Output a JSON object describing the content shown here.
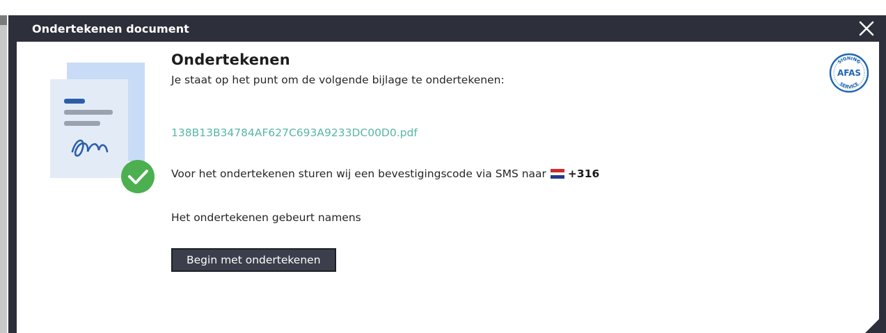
{
  "dialog": {
    "title": "Ondertekenen document",
    "close_icon": "close-icon"
  },
  "content": {
    "heading": "Ondertekenen",
    "intro": "Je staat op het punt om de volgende bijlage te ondertekenen:",
    "attachment_filename": "138B13B34784AF627C693A9233DC00D0.pdf",
    "sms_text": "Voor het ondertekenen sturen wij een bevestigingscode via SMS naar",
    "phone_prefix": "+316",
    "behalf_text": "Het ondertekenen gebeurt namens",
    "begin_button_label": "Begin met ondertekenen"
  },
  "badge": {
    "top_text": "SIGNING",
    "brand_text": "AFAS",
    "bottom_text": "SERVICE"
  },
  "colors": {
    "titlebar": "#2d2f3a",
    "link": "#58b7a6",
    "button": "#3b3f4c",
    "check_green": "#4caf50",
    "afas_blue": "#1f66b3"
  },
  "icons": {
    "document": "document-signature-icon",
    "check": "check-circle-icon",
    "flag": "netherlands-flag-icon",
    "badge": "afas-signing-service-badge"
  }
}
